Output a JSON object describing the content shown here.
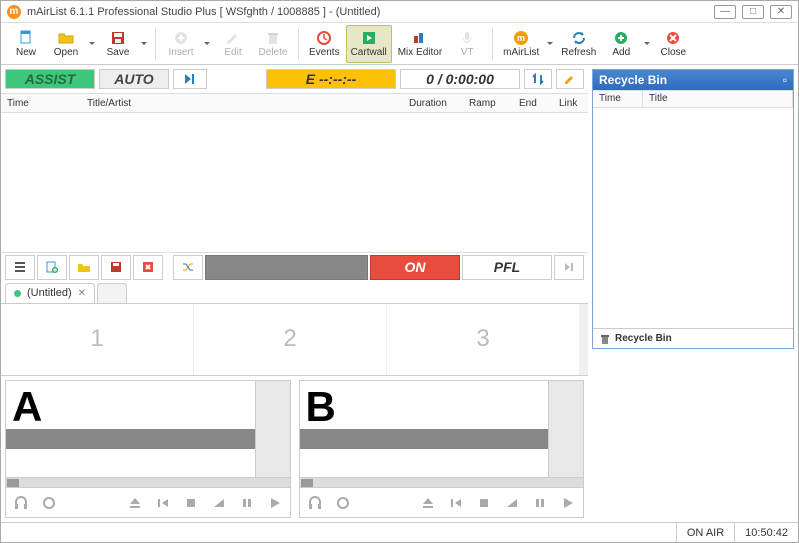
{
  "window": {
    "title": "mAirList 6.1.1 Professional Studio Plus [ WSfghth / 1008885 ] - (Untitled)"
  },
  "toolbar": {
    "new": "New",
    "open": "Open",
    "save": "Save",
    "insert": "Insert",
    "edit": "Edit",
    "delete": "Delete",
    "events": "Events",
    "cartwall": "Cartwall",
    "mixeditor": "Mix Editor",
    "vt": "VT",
    "mairlist": "mAirList",
    "refresh": "Refresh",
    "add": "Add",
    "close": "Close"
  },
  "controls": {
    "assist": "ASSIST",
    "auto": "AUTO",
    "time_e": "E  --:--:--",
    "time_total": "0 / 0:00:00",
    "on": "ON",
    "pfl": "PFL"
  },
  "playlist": {
    "cols": {
      "time": "Time",
      "title": "Title/Artist",
      "duration": "Duration",
      "ramp": "Ramp",
      "end": "End",
      "link": "Link"
    }
  },
  "tabs": {
    "untitled": "(Untitled)"
  },
  "carts": {
    "s1": "1",
    "s2": "2",
    "s3": "3"
  },
  "players": {
    "a": "A",
    "b": "B"
  },
  "recycle": {
    "title": "Recycle Bin",
    "col_time": "Time",
    "col_title": "Title",
    "footer": "Recycle Bin"
  },
  "status": {
    "onair": "ON AIR",
    "clock": "10:50:42"
  }
}
